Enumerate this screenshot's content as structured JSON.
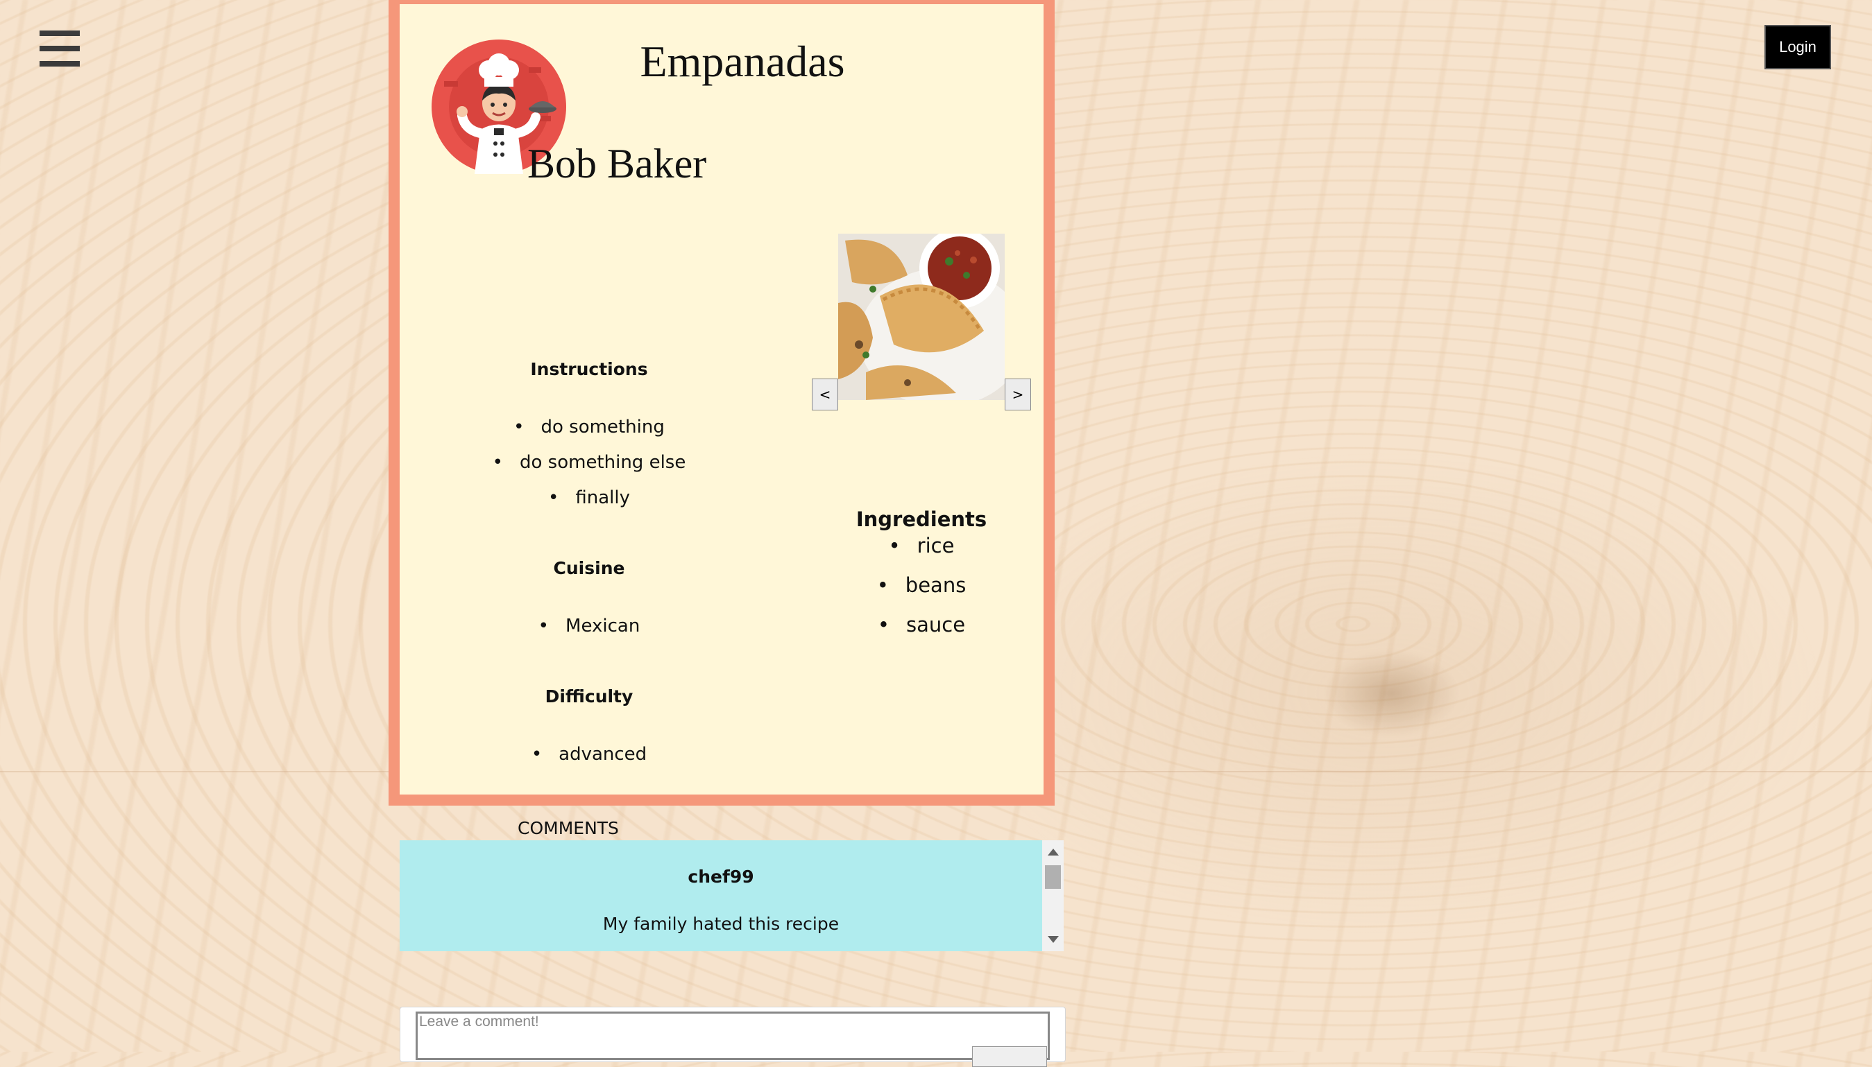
{
  "header": {
    "login_label": "Login"
  },
  "recipe": {
    "title": "Empanadas",
    "author": "Bob Baker",
    "instructions": {
      "heading": "Instructions",
      "items": [
        "do something",
        "do something else",
        "finally"
      ]
    },
    "cuisine": {
      "heading": "Cuisine",
      "items": [
        "Mexican"
      ]
    },
    "difficulty": {
      "heading": "Difficulty",
      "items": [
        "advanced"
      ]
    },
    "ingredients": {
      "heading": "Ingredients",
      "items": [
        "rice",
        "beans",
        "sauce"
      ]
    },
    "gallery": {
      "prev_label": "<",
      "next_label": ">"
    }
  },
  "comments": {
    "label": "COMMENTS",
    "items": [
      {
        "user": "chef99",
        "text": "My family hated this recipe"
      }
    ],
    "placeholder": "Leave a comment!"
  },
  "colors": {
    "card_bg": "#fff7d8",
    "card_border": "#f5977a",
    "comment_bg": "#b0ecee",
    "avatar_red": "#e8524b"
  }
}
